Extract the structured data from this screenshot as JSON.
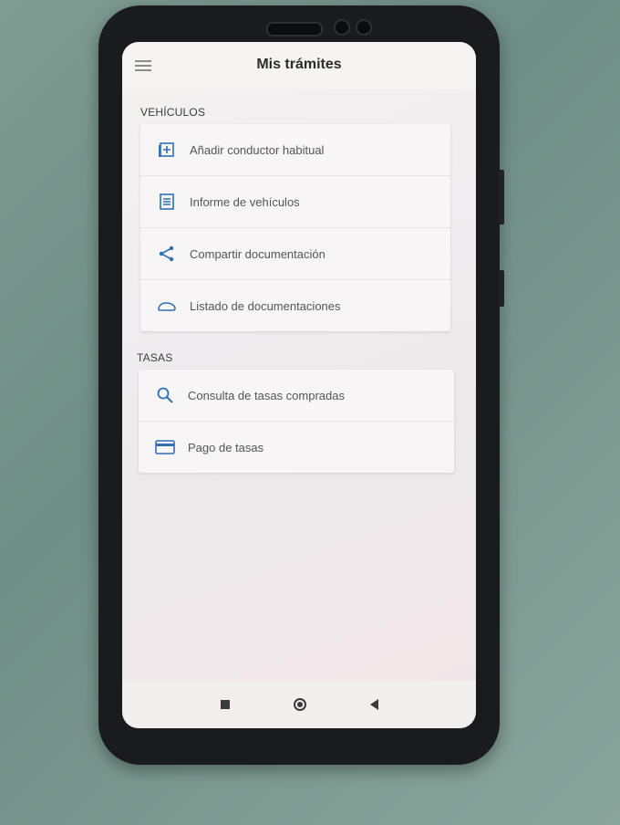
{
  "app": {
    "title": "Mis trámites"
  },
  "sections": [
    {
      "label": "VEHÍCULOS",
      "items": [
        {
          "label": "Añadir conductor habitual",
          "icon": "add-box-icon"
        },
        {
          "label": "Informe de vehículos",
          "icon": "document-icon"
        },
        {
          "label": "Compartir documentación",
          "icon": "share-icon"
        },
        {
          "label": "Listado de documentaciones",
          "icon": "car-icon"
        }
      ]
    },
    {
      "label": "TASAS",
      "items": [
        {
          "label": "Consulta de tasas compradas",
          "icon": "search-icon"
        },
        {
          "label": "Pago de tasas",
          "icon": "credit-card-icon"
        }
      ]
    }
  ],
  "colors": {
    "accent": "#2f6fb5",
    "background": "#f4f1f0"
  }
}
